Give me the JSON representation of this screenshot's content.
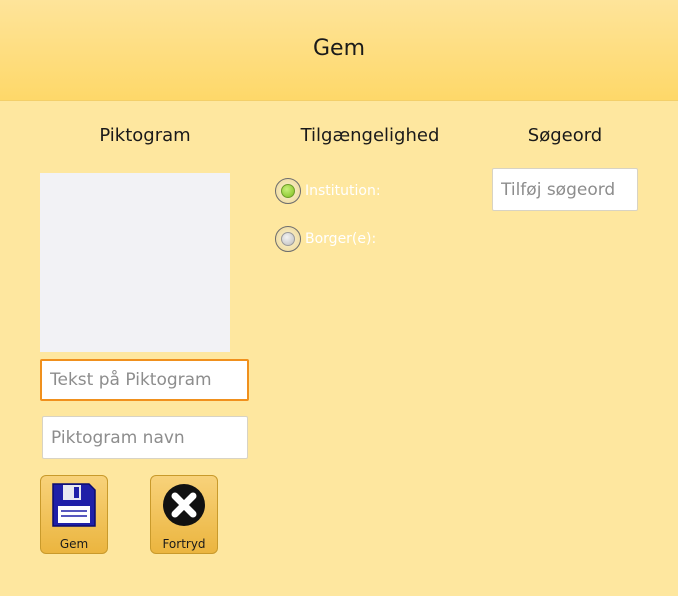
{
  "header": {
    "title": "Gem"
  },
  "columns": {
    "pictogram": "Piktogram",
    "availability": "Tilgængelighed",
    "keywords": "Søgeord"
  },
  "fields": {
    "pictogram_text_placeholder": "Tekst på Piktogram",
    "pictogram_name_placeholder": "Piktogram navn",
    "keyword_placeholder": "Tilføj søgeord"
  },
  "availability": {
    "options": [
      {
        "label": "Institution:",
        "selected": true
      },
      {
        "label": "Borger(e):",
        "selected": false
      }
    ]
  },
  "buttons": {
    "save_label": "Gem",
    "cancel_label": "Fortryd",
    "save_icon": "floppy-disk-icon",
    "cancel_icon": "close-circle-icon"
  },
  "colors": {
    "header_bg": "#fed869",
    "page_bg": "#fee79f",
    "focus_border": "#f0901d",
    "button_bg": "#ebb53f",
    "radio_selected": "#7fbf1f"
  }
}
